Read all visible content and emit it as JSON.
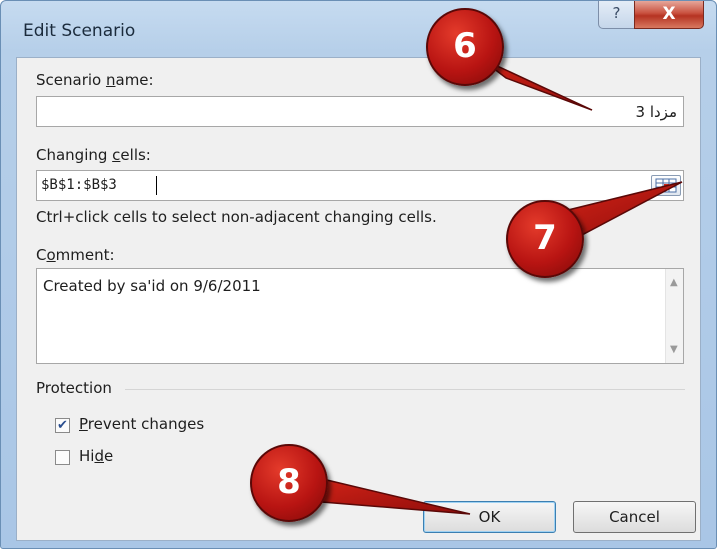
{
  "dialog": {
    "title": "Edit Scenario",
    "help_glyph": "?",
    "close_glyph": "X"
  },
  "scenario_name": {
    "label_pre": "Scenario ",
    "label_u": "n",
    "label_post": "ame:",
    "value": "مزدا 3"
  },
  "changing_cells": {
    "label_pre": "Changing ",
    "label_u": "c",
    "label_post": "ells:",
    "value": "$B$1:$B$3",
    "hint": "Ctrl+click cells to select non-adjacent changing cells."
  },
  "comment": {
    "label_pre": "C",
    "label_u": "o",
    "label_post": "mment:",
    "value": "Created by sa'id on 9/6/2011"
  },
  "protection": {
    "title": "Protection",
    "prevent_pre": "",
    "prevent_u": "P",
    "prevent_post": "revent changes",
    "prevent_checked": true,
    "hide_pre": "Hi",
    "hide_u": "d",
    "hide_post": "e",
    "hide_checked": false
  },
  "buttons": {
    "ok": "OK",
    "cancel": "Cancel"
  },
  "callouts": {
    "c6": "6",
    "c7": "7",
    "c8": "8"
  },
  "colors": {
    "callout": "#b81412",
    "title_bar": "#b6cfe9",
    "client": "#f0f0f0"
  },
  "icons": {
    "collapse": "range-select-icon",
    "check": "check-icon"
  }
}
